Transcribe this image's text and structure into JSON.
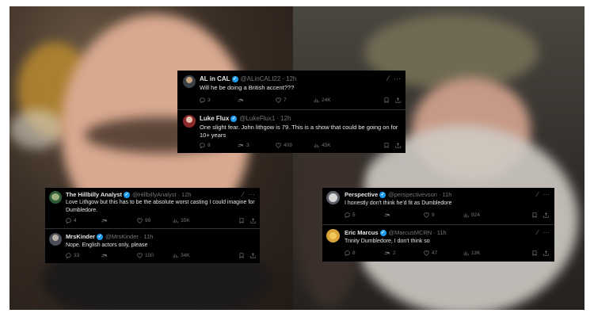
{
  "cards": [
    {
      "id": "top",
      "tweets": [
        {
          "name": "AL in CAL",
          "handle": "@ALinCALI22",
          "time": "12h",
          "text": "Will he be doing a British accent???",
          "replies": "3",
          "reposts": "",
          "likes": "7",
          "views": "24K",
          "avatar_color": "#3b3f46"
        },
        {
          "name": "Luke Flux",
          "handle": "@LukeFlux1",
          "time": "12h",
          "text": "One slight fear. John lithgow is 79. This is a show that could be going on for 10+ years",
          "replies": "8",
          "reposts": "3",
          "likes": "409",
          "views": "45K",
          "avatar_color": "#8a2a2a"
        }
      ]
    },
    {
      "id": "left",
      "tweets": [
        {
          "name": "The Hillbilly Analyst",
          "handle": "@HillbillyAnalyst",
          "time": "12h",
          "text": "Love Lithgow but this has to be the absolute worst casting I could imagine for Dumbledore.",
          "replies": "4",
          "reposts": "",
          "likes": "99",
          "views": "35K",
          "avatar_color": "#2f5a3a"
        },
        {
          "name": "MrsKinder",
          "handle": "@MrsKinder",
          "time": "11h",
          "text": "Nope. English actors only, please",
          "replies": "33",
          "reposts": "",
          "likes": "100",
          "views": "34K",
          "avatar_color": "#4b4f57"
        }
      ]
    },
    {
      "id": "right",
      "tweets": [
        {
          "name": "Perspective",
          "handle": "@perspectivevson",
          "time": "11h",
          "text": "I honestly don't think he'd fit as Dumbledore",
          "replies": "5",
          "reposts": "",
          "likes": "9",
          "views": "924",
          "avatar_color": "#5a5e66"
        },
        {
          "name": "Eric Marcus",
          "handle": "@MarcusMCRN",
          "time": "11h",
          "text": "Trinity Dumbledore, I don't think so",
          "replies": "8",
          "reposts": "2",
          "likes": "47",
          "views": "13K",
          "avatar_color": "#d9a33a"
        }
      ]
    }
  ],
  "colors": {
    "card_bg": "#000000",
    "text": "#e7e9ea",
    "muted": "#71767b",
    "verified": "#1d9bf0",
    "divider": "#2f3336"
  },
  "icons": [
    "verified-badge-icon",
    "grok-icon",
    "more-icon",
    "reply-icon",
    "repost-icon",
    "like-icon",
    "views-icon",
    "bookmark-icon",
    "share-icon"
  ]
}
